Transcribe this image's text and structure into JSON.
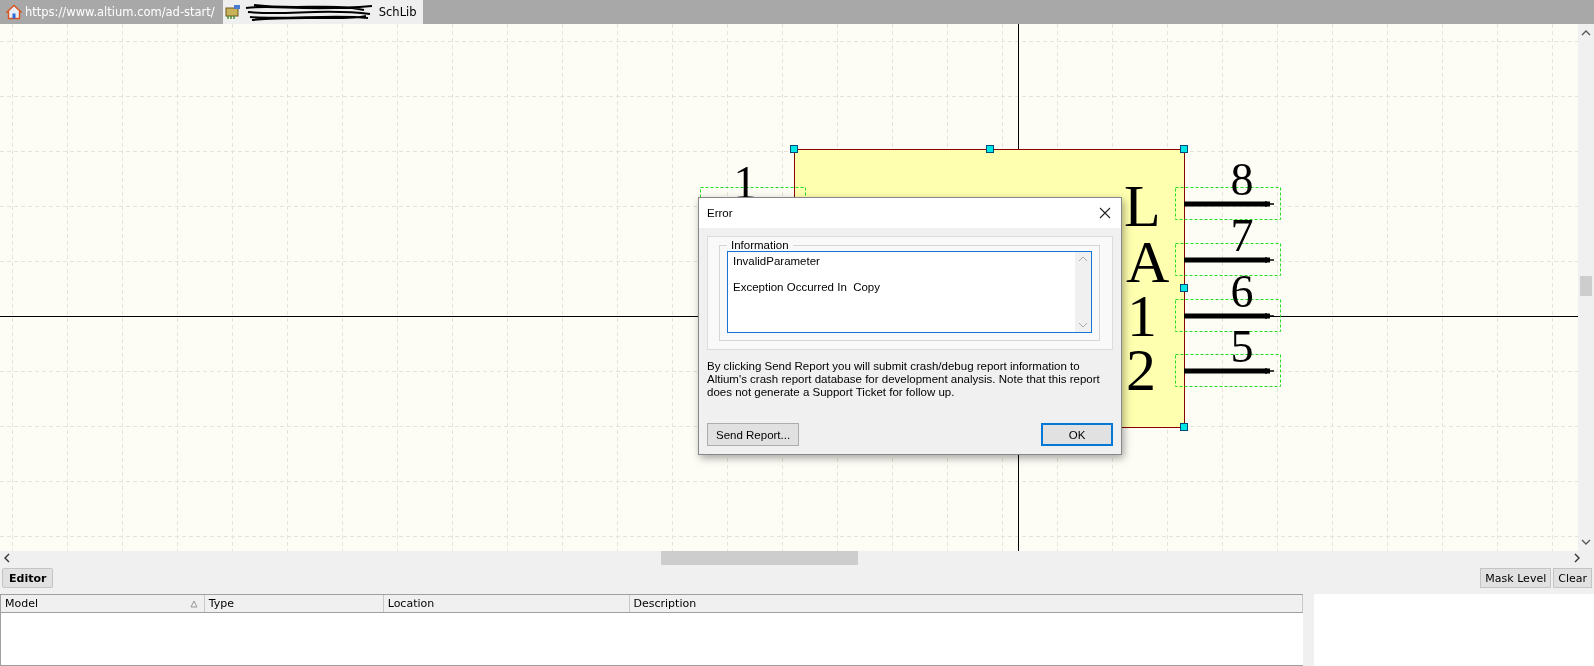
{
  "tabs": [
    {
      "label": "https://www.altium.com/ad-start/",
      "kind": "home",
      "selected": false
    },
    {
      "label": "SchLib",
      "kind": "library",
      "selected": true
    }
  ],
  "schematic": {
    "pins": [
      {
        "number": "1"
      },
      {
        "number": "8"
      },
      {
        "number": "7"
      },
      {
        "number": "6"
      },
      {
        "number": "5"
      }
    ],
    "labels": [
      {
        "text": "L"
      },
      {
        "text": "A"
      },
      {
        "text": "1"
      },
      {
        "text": "2"
      }
    ]
  },
  "dialog": {
    "title": "Error",
    "group_label": "Information",
    "details": "InvalidParameter\n\nException Occurred In  Copy",
    "message": "By clicking Send Report you will submit crash/debug report information to Altium's crash report database for development analysis. Note that this report does not generate a Support Ticket for follow up.",
    "buttons": [
      {
        "label": "Send Report...",
        "default": false
      },
      {
        "label": "OK",
        "default": true
      }
    ]
  },
  "panel": {
    "tab": "Editor",
    "buttons": [
      "Mask Level",
      "Clear"
    ],
    "columns": [
      {
        "label": "Model",
        "sorted": true
      },
      {
        "label": "Type",
        "sorted": false
      },
      {
        "label": "Location",
        "sorted": false
      },
      {
        "label": "Description",
        "sorted": false
      }
    ]
  }
}
